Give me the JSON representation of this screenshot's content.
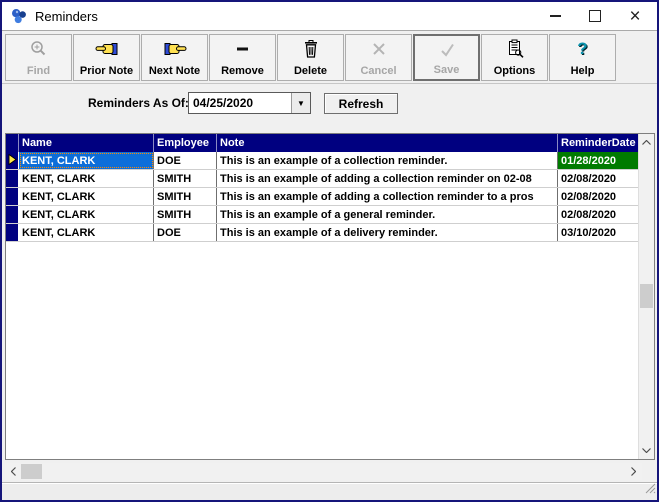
{
  "window": {
    "title": "Reminders"
  },
  "titlebar": {
    "minimize": "minimize",
    "maximize": "maximize",
    "close": "×"
  },
  "toolbar": {
    "buttons": [
      {
        "id": "find",
        "label": "Find",
        "icon": "magnifier-icon",
        "disabled": true,
        "default": false
      },
      {
        "id": "prior-note",
        "label": "Prior Note",
        "icon": "hand-left-icon",
        "disabled": false,
        "default": false
      },
      {
        "id": "next-note",
        "label": "Next Note",
        "icon": "hand-right-icon",
        "disabled": false,
        "default": false
      },
      {
        "id": "remove",
        "label": "Remove",
        "icon": "minus-icon",
        "disabled": false,
        "default": false
      },
      {
        "id": "delete",
        "label": "Delete",
        "icon": "trash-icon",
        "disabled": false,
        "default": false
      },
      {
        "id": "cancel",
        "label": "Cancel",
        "icon": "x-icon",
        "disabled": true,
        "default": false
      },
      {
        "id": "save",
        "label": "Save",
        "icon": "check-icon",
        "disabled": true,
        "default": true
      },
      {
        "id": "options",
        "label": "Options",
        "icon": "options-icon",
        "disabled": false,
        "default": false
      },
      {
        "id": "help",
        "label": "Help",
        "icon": "help-icon",
        "disabled": false,
        "default": false
      }
    ]
  },
  "filter": {
    "label": "Reminders As Of:",
    "date_value": "04/25/2020",
    "refresh_label": "Refresh"
  },
  "grid": {
    "columns": [
      "Name",
      "Employee",
      "Note",
      "ReminderDate"
    ],
    "rows": [
      {
        "name": "KENT, CLARK",
        "employee": "DOE",
        "note": "This is an example of a collection reminder.",
        "date": "01/28/2020",
        "selected": true,
        "date_green": true
      },
      {
        "name": "KENT, CLARK",
        "employee": "SMITH",
        "note": "This is an example of adding a collection reminder on 02-08",
        "date": "02/08/2020",
        "selected": false,
        "date_green": false
      },
      {
        "name": "KENT, CLARK",
        "employee": "SMITH",
        "note": "This is an example of adding a collection reminder to a pros",
        "date": "02/08/2020",
        "selected": false,
        "date_green": false
      },
      {
        "name": "KENT, CLARK",
        "employee": "SMITH",
        "note": "This is an example of a general reminder.",
        "date": "02/08/2020",
        "selected": false,
        "date_green": false
      },
      {
        "name": "KENT, CLARK",
        "employee": "DOE",
        "note": "This is an example of a delivery reminder.",
        "date": "03/10/2020",
        "selected": false,
        "date_green": false
      }
    ]
  },
  "colors": {
    "window_border": "#15157a",
    "header_bg": "#000080",
    "selected_cell_bg": "#0d6ed9",
    "selected_outline": "#ff8a00",
    "date_highlight_bg": "#007b00",
    "row_arrow": "#ffe94a",
    "help_icon": "#0b93ad"
  }
}
